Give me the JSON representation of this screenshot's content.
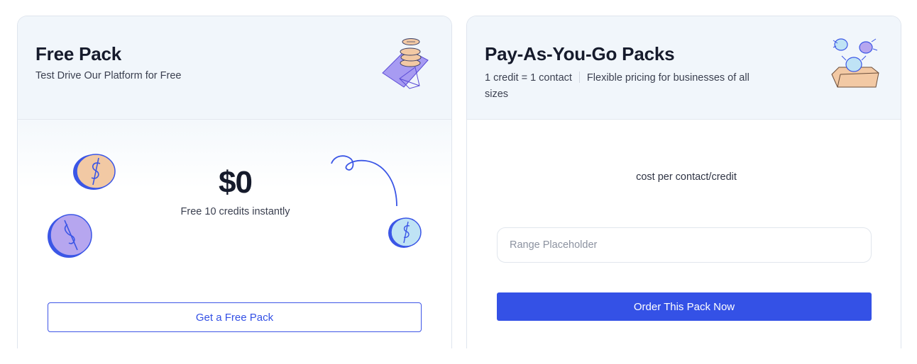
{
  "free_pack": {
    "title": "Free Pack",
    "subtitle": "Test Drive Our Platform for Free",
    "price": "$0",
    "price_note": "Free 10 credits instantly",
    "button_label": "Get a Free Pack"
  },
  "payg": {
    "title": "Pay-As-You-Go Packs",
    "subtitle_part1": "1 credit = 1 contact",
    "subtitle_part2": "Flexible pricing for businesses of all sizes",
    "cost_label": "cost per contact/credit",
    "range_placeholder": "Range Placeholder",
    "button_label": "Order This Pack Now"
  },
  "colors": {
    "accent": "#3451e6",
    "header_bg": "#f1f6fb",
    "coin_peach": "#f2c9a4",
    "coin_purple": "#b6a6ef",
    "coin_blue": "#bfe3f5"
  },
  "icons": {
    "free_header": "coin-stack-illustration-icon",
    "payg_header": "coins-into-box-illustration-icon",
    "coins": "dollar-coin-icon",
    "swirl": "swirl-line-icon"
  }
}
